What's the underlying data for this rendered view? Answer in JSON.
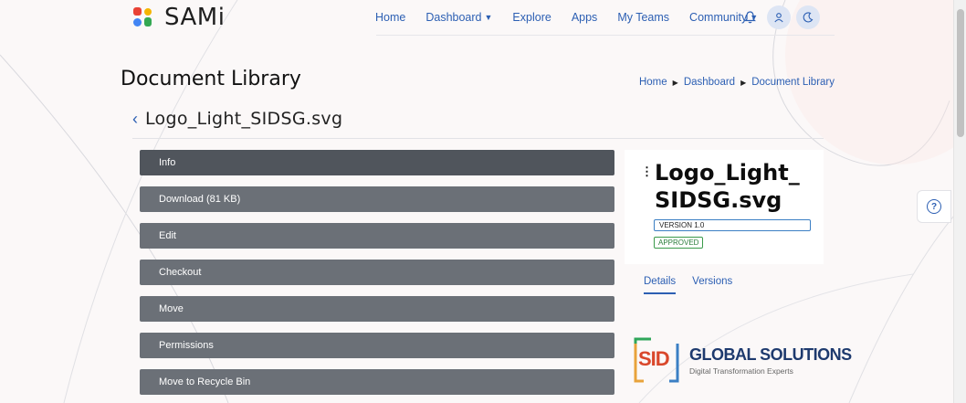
{
  "app": {
    "name": "SAMi"
  },
  "nav": {
    "items": [
      {
        "label": "Home"
      },
      {
        "label": "Dashboard",
        "dropdown": true
      },
      {
        "label": "Explore"
      },
      {
        "label": "Apps"
      },
      {
        "label": "My Teams"
      },
      {
        "label": "Community",
        "dropdown": true
      }
    ],
    "icons": [
      "bell-icon",
      "user-icon",
      "moon-icon"
    ]
  },
  "page": {
    "title": "Document Library"
  },
  "breadcrumb": [
    "Home",
    "Dashboard",
    "Document Library"
  ],
  "document": {
    "name": "Logo_Light_SIDSG.svg",
    "card_name_line1": "Logo_Light_",
    "card_name_line2": "SIDSG.svg",
    "version": "VERSION 1.0",
    "status": "APPROVED"
  },
  "actions": [
    {
      "label": "Info",
      "active": true
    },
    {
      "label": "Download (81 KB)"
    },
    {
      "label": "Edit"
    },
    {
      "label": "Checkout"
    },
    {
      "label": "Move"
    },
    {
      "label": "Permissions"
    },
    {
      "label": "Move to Recycle Bin"
    }
  ],
  "tabs": [
    {
      "label": "Details",
      "active": true
    },
    {
      "label": "Versions"
    }
  ],
  "preview": {
    "mark": "SID",
    "headline": "GLOBAL SOLUTIONS",
    "tagline": "Digital Transformation Experts"
  },
  "colors": {
    "accent": "#2c5fb3",
    "action_bg": "#6b7077",
    "action_active_bg": "#50555c"
  }
}
